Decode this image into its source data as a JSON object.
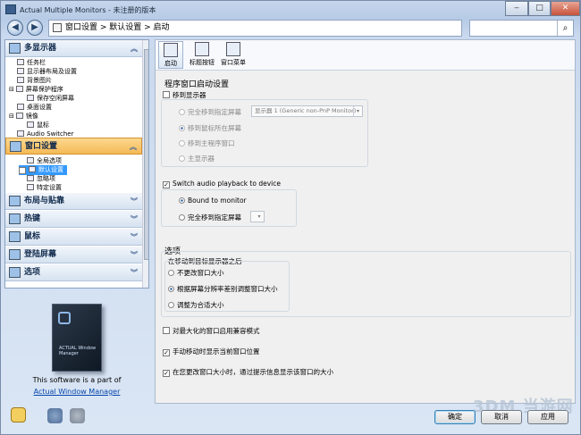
{
  "window": {
    "title": "Actual Multiple Monitors - 未注册的版本"
  },
  "nav": {
    "breadcrumb": "窗口设置 > 默认设置 > 启动",
    "search_placeholder": ""
  },
  "sidebar": {
    "sections": [
      {
        "label": "多显示器"
      },
      {
        "label": "窗口设置"
      },
      {
        "label": "布局与贴靠"
      },
      {
        "label": "热键"
      },
      {
        "label": "鼠标"
      },
      {
        "label": "登陆屏幕"
      },
      {
        "label": "选项"
      }
    ],
    "tree_monitors": [
      "任务栏",
      "显示器布局及设置",
      "背景图片",
      "屏幕保护程序",
      "保存空闲屏幕",
      "桌面设置",
      "镜像",
      "鼠标",
      "Audio Switcher"
    ],
    "tree_window": [
      "全局选项",
      "默认设置",
      "忽略项",
      "特定设置"
    ]
  },
  "promo": {
    "text": "This software is a part of",
    "link": "Actual Window Manager",
    "box_caption": "ACTUAL Window Manager"
  },
  "tabs": {
    "startup": "启动",
    "title_buttons": "标题按钮",
    "window_menu": "窗口菜单"
  },
  "startup": {
    "group_title": "程序窗口启动设置",
    "move_to_monitor": "移到显示器",
    "fully_move_specified": "完全移到指定屏幕",
    "monitor_select": "显示器 1 (Generic non-PnP Monitor)",
    "move_mouse_screen": "移到鼠标所在屏幕",
    "move_main_screen": "移到主程序窗口",
    "main_monitor": "主显示器",
    "switch_audio": "Switch audio playback to device",
    "bound_to_monitor": "Bound to monitor",
    "fully_move_specified2": "完全移到指定屏幕"
  },
  "options": {
    "title": "选项",
    "after_move_title": "在移动到目标显示器之后",
    "no_resize": "不更改窗口大小",
    "resize_by_resolution": "根据屏幕分辨率差别调整窗口大小",
    "fit_size": "调整为合适大小",
    "compat_maximized": "对最大化的窗口启用兼容模式",
    "show_pos_manual": "手动移动时显示当前窗口位置",
    "show_size_tooltip": "在您更改窗口大小时，通过提示信息显示该窗口的大小"
  },
  "buttons": {
    "ok": "确定",
    "cancel": "取消",
    "apply": "应用"
  },
  "watermark": "3DM 当游网"
}
